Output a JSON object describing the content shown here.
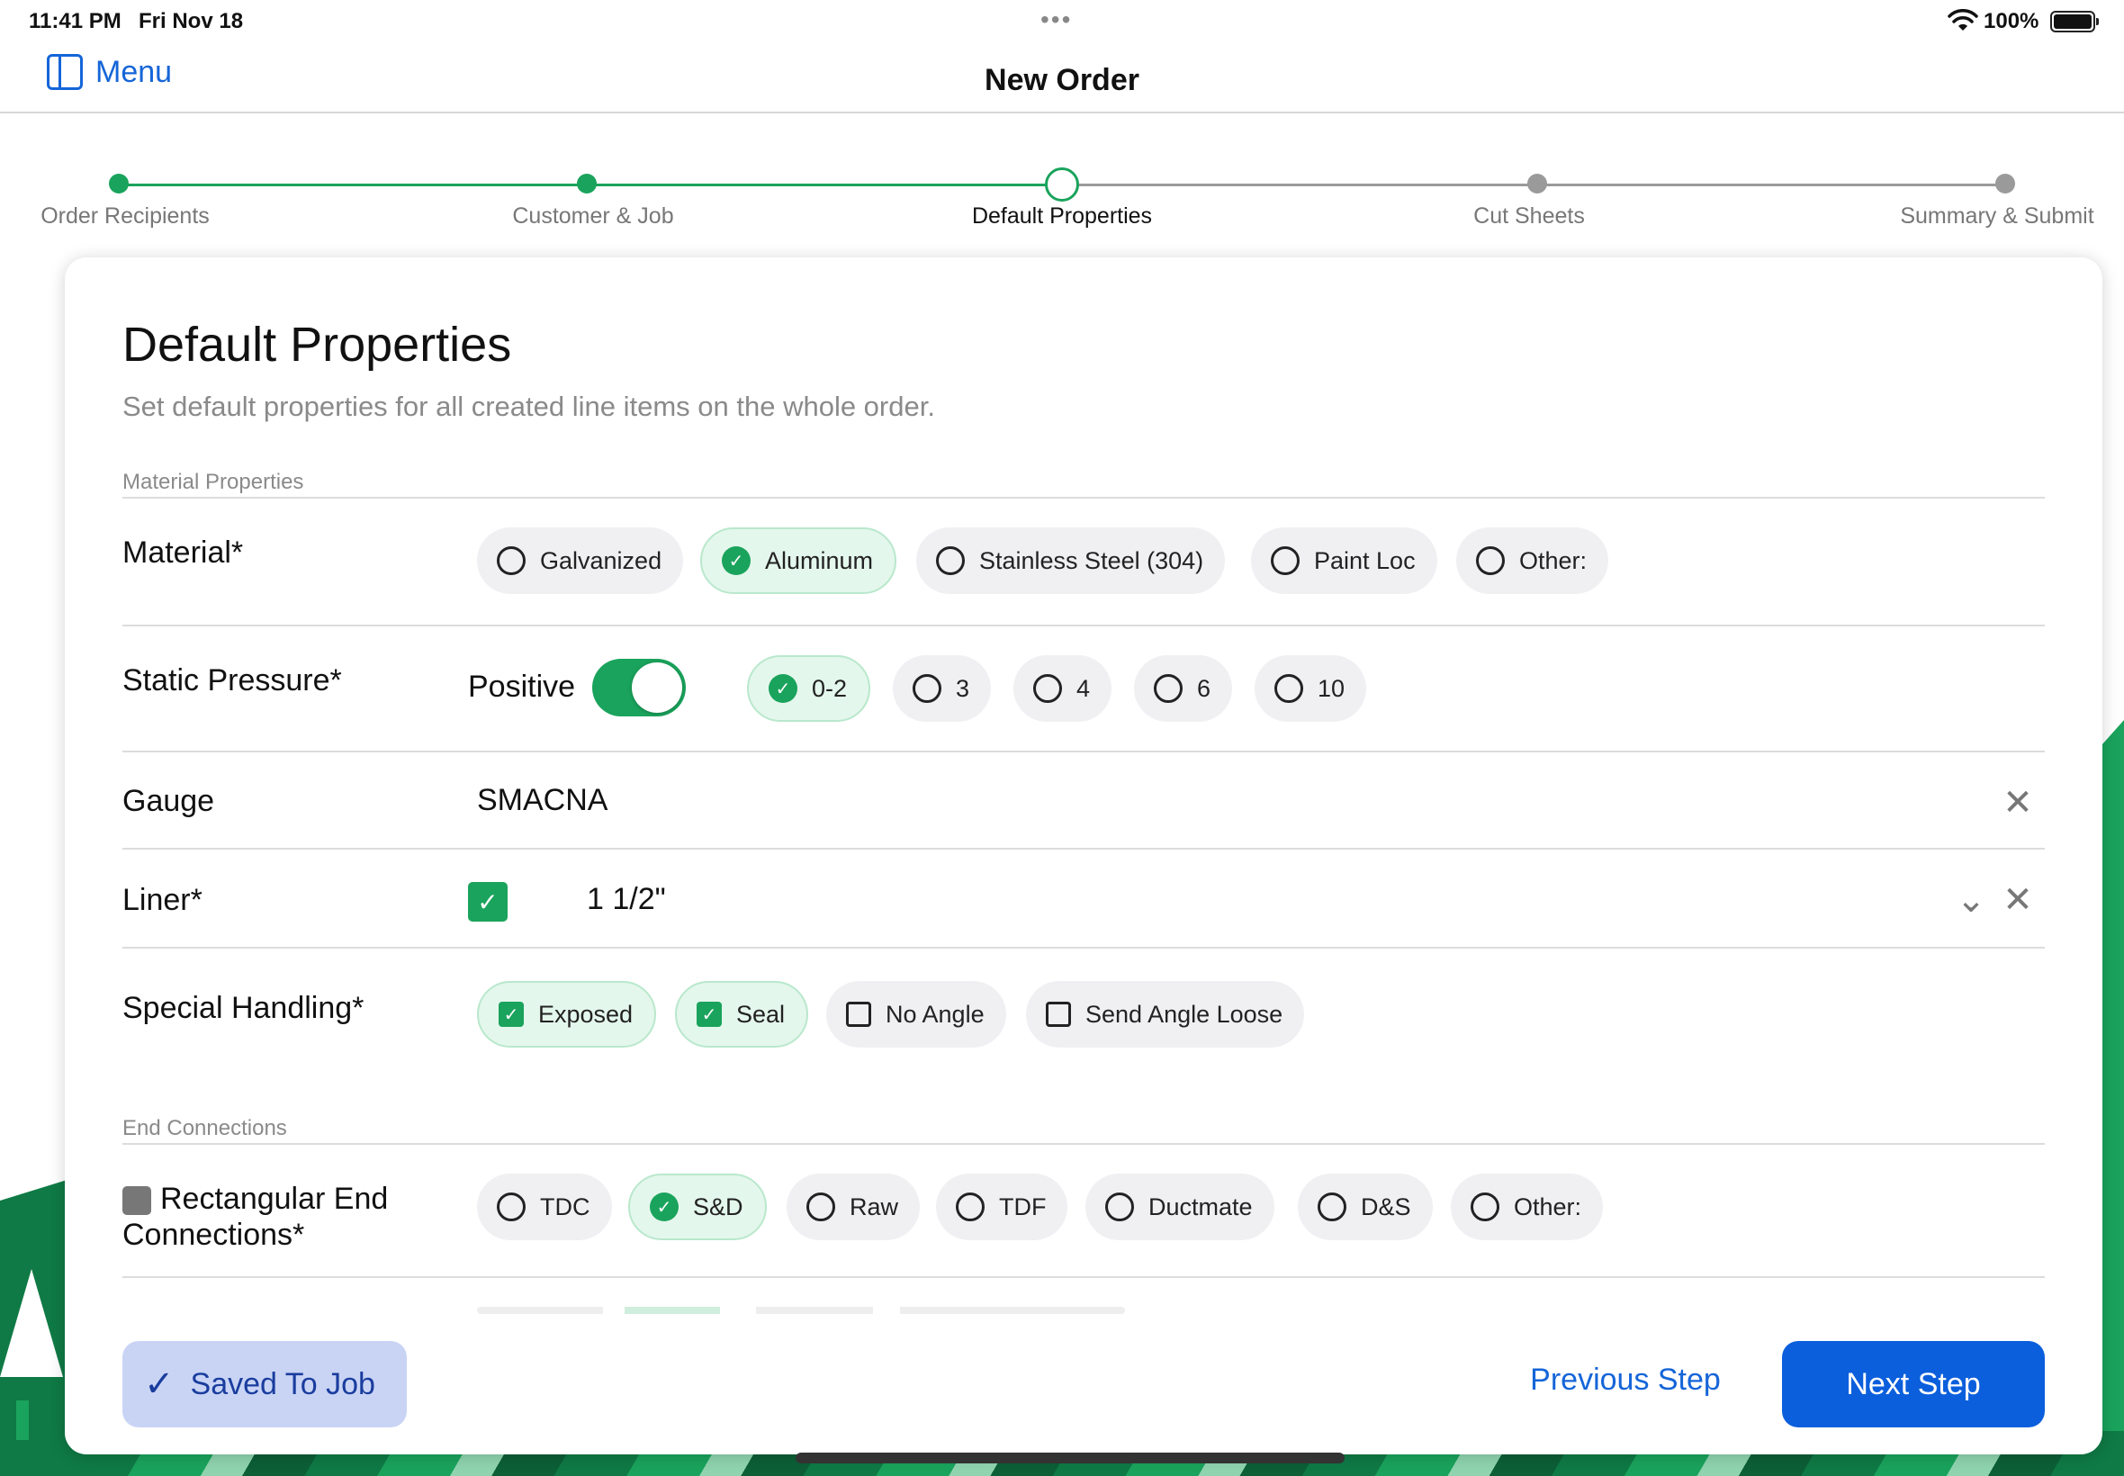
{
  "status_bar": {
    "time": "11:41 PM",
    "date": "Fri Nov 18",
    "dots": "•••",
    "battery": "100%"
  },
  "nav": {
    "menu_label": "Menu",
    "title": "New Order"
  },
  "stepper": {
    "steps": [
      {
        "label": "Order Recipients",
        "state": "complete"
      },
      {
        "label": "Customer & Job",
        "state": "complete"
      },
      {
        "label": "Default Properties",
        "state": "current"
      },
      {
        "label": "Cut Sheets",
        "state": "upcoming"
      },
      {
        "label": "Summary & Submit",
        "state": "upcoming"
      }
    ]
  },
  "card": {
    "title": "Default Properties",
    "subtitle": "Set default properties for all created line items on the whole order.",
    "sections": {
      "material_properties": "Material Properties",
      "end_connections": "End Connections"
    }
  },
  "material": {
    "label": "Material*",
    "options": [
      {
        "label": "Galvanized",
        "selected": false
      },
      {
        "label": "Aluminum",
        "selected": true
      },
      {
        "label": "Stainless Steel (304)",
        "selected": false
      },
      {
        "label": "Paint Loc",
        "selected": false
      },
      {
        "label": "Other:",
        "selected": false
      }
    ]
  },
  "static_pressure": {
    "label": "Static Pressure*",
    "toggle_label": "Positive",
    "toggle_on": true,
    "options": [
      {
        "label": "0-2",
        "selected": true
      },
      {
        "label": "3",
        "selected": false
      },
      {
        "label": "4",
        "selected": false
      },
      {
        "label": "6",
        "selected": false
      },
      {
        "label": "10",
        "selected": false
      }
    ]
  },
  "gauge": {
    "label": "Gauge",
    "value": "SMACNA"
  },
  "liner": {
    "label": "Liner*",
    "checked": true,
    "value": "1 1/2\""
  },
  "special_handling": {
    "label": "Special Handling*",
    "options": [
      {
        "label": "Exposed",
        "checked": true
      },
      {
        "label": "Seal",
        "checked": true
      },
      {
        "label": "No Angle",
        "checked": false
      },
      {
        "label": "Send Angle Loose",
        "checked": false
      }
    ]
  },
  "rect_end": {
    "label_line1": "Rectangular End",
    "label_line2": "Connections*",
    "options": [
      {
        "label": "TDC",
        "selected": false
      },
      {
        "label": "S&D",
        "selected": true
      },
      {
        "label": "Raw",
        "selected": false
      },
      {
        "label": "TDF",
        "selected": false
      },
      {
        "label": "Ductmate",
        "selected": false
      },
      {
        "label": "D&S",
        "selected": false
      },
      {
        "label": "Other:",
        "selected": false
      }
    ]
  },
  "footer": {
    "saved_label": "Saved To Job",
    "prev_label": "Previous Step",
    "next_label": "Next Step"
  },
  "colors": {
    "accent_green": "#1aa35c",
    "accent_blue": "#0b5fdc",
    "link_blue": "#1565d8"
  }
}
